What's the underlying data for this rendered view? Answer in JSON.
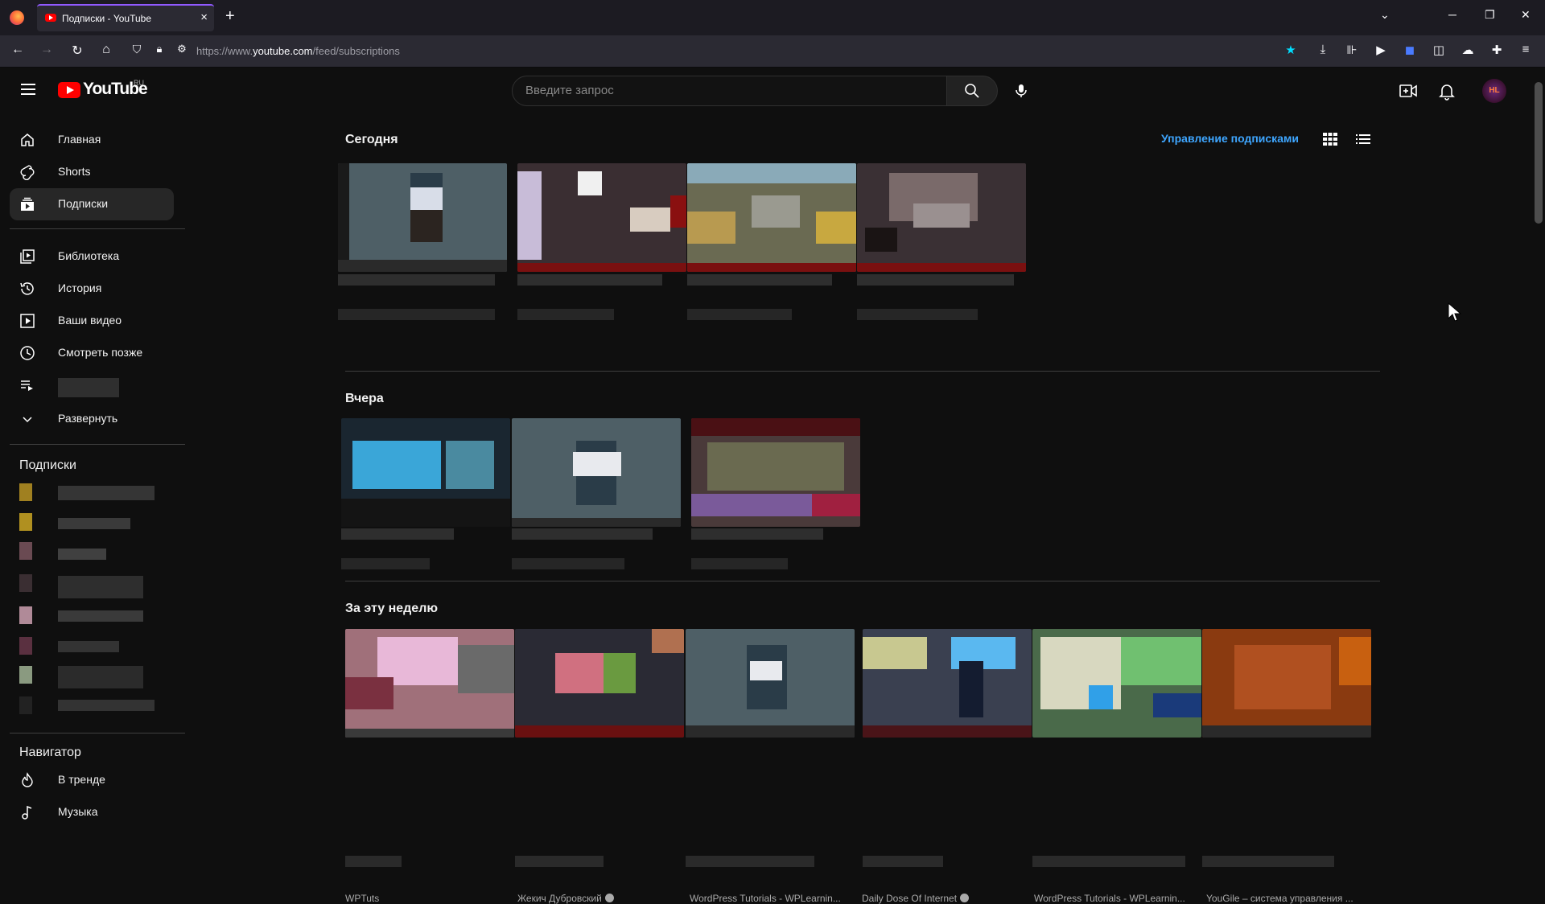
{
  "browser": {
    "tab_title": "Подписки - YouTube",
    "url_prefix": "https://www.",
    "url_host": "youtube.com",
    "url_path": "/feed/subscriptions"
  },
  "masthead": {
    "logo_text": "YouTube",
    "region": "RU",
    "search_placeholder": "Введите запрос",
    "avatar_text": "HL"
  },
  "sidebar": {
    "items": [
      {
        "label": "Главная",
        "icon": "home-icon"
      },
      {
        "label": "Shorts",
        "icon": "shorts-icon"
      },
      {
        "label": "Подписки",
        "icon": "subscriptions-icon",
        "active": true
      },
      {
        "label": "Библиотека",
        "icon": "library-icon"
      },
      {
        "label": "История",
        "icon": "history-icon"
      },
      {
        "label": "Ваши видео",
        "icon": "your-videos-icon"
      },
      {
        "label": "Смотреть позже",
        "icon": "watch-later-icon"
      },
      {
        "label": "Развернуть",
        "icon": "chevron-down-icon"
      }
    ],
    "subscriptions_heading": "Подписки",
    "navigator_heading": "Навигатор",
    "navigator_items": [
      {
        "label": "В тренде",
        "icon": "trending-icon"
      },
      {
        "label": "Музыка",
        "icon": "music-icon"
      }
    ]
  },
  "main": {
    "manage_link": "Управление подписками",
    "sections": [
      {
        "title": "Сегодня"
      },
      {
        "title": "Вчера"
      },
      {
        "title": "За эту неделю"
      }
    ],
    "week_channels": [
      {
        "name": "WPTuts",
        "verified": false
      },
      {
        "name": "Жекич Дубровский",
        "verified": true
      },
      {
        "name": "WordPress Tutorials - WPLearnin...",
        "verified": false
      },
      {
        "name": "Daily Dose Of Internet",
        "verified": true
      },
      {
        "name": "WordPress Tutorials - WPLearnin...",
        "verified": false
      },
      {
        "name": "YouGile – система управления ...",
        "verified": false
      }
    ]
  },
  "colors": {
    "accent_link": "#3ea6ff",
    "brand_red": "#ff0000",
    "background": "#0f0f0f"
  }
}
